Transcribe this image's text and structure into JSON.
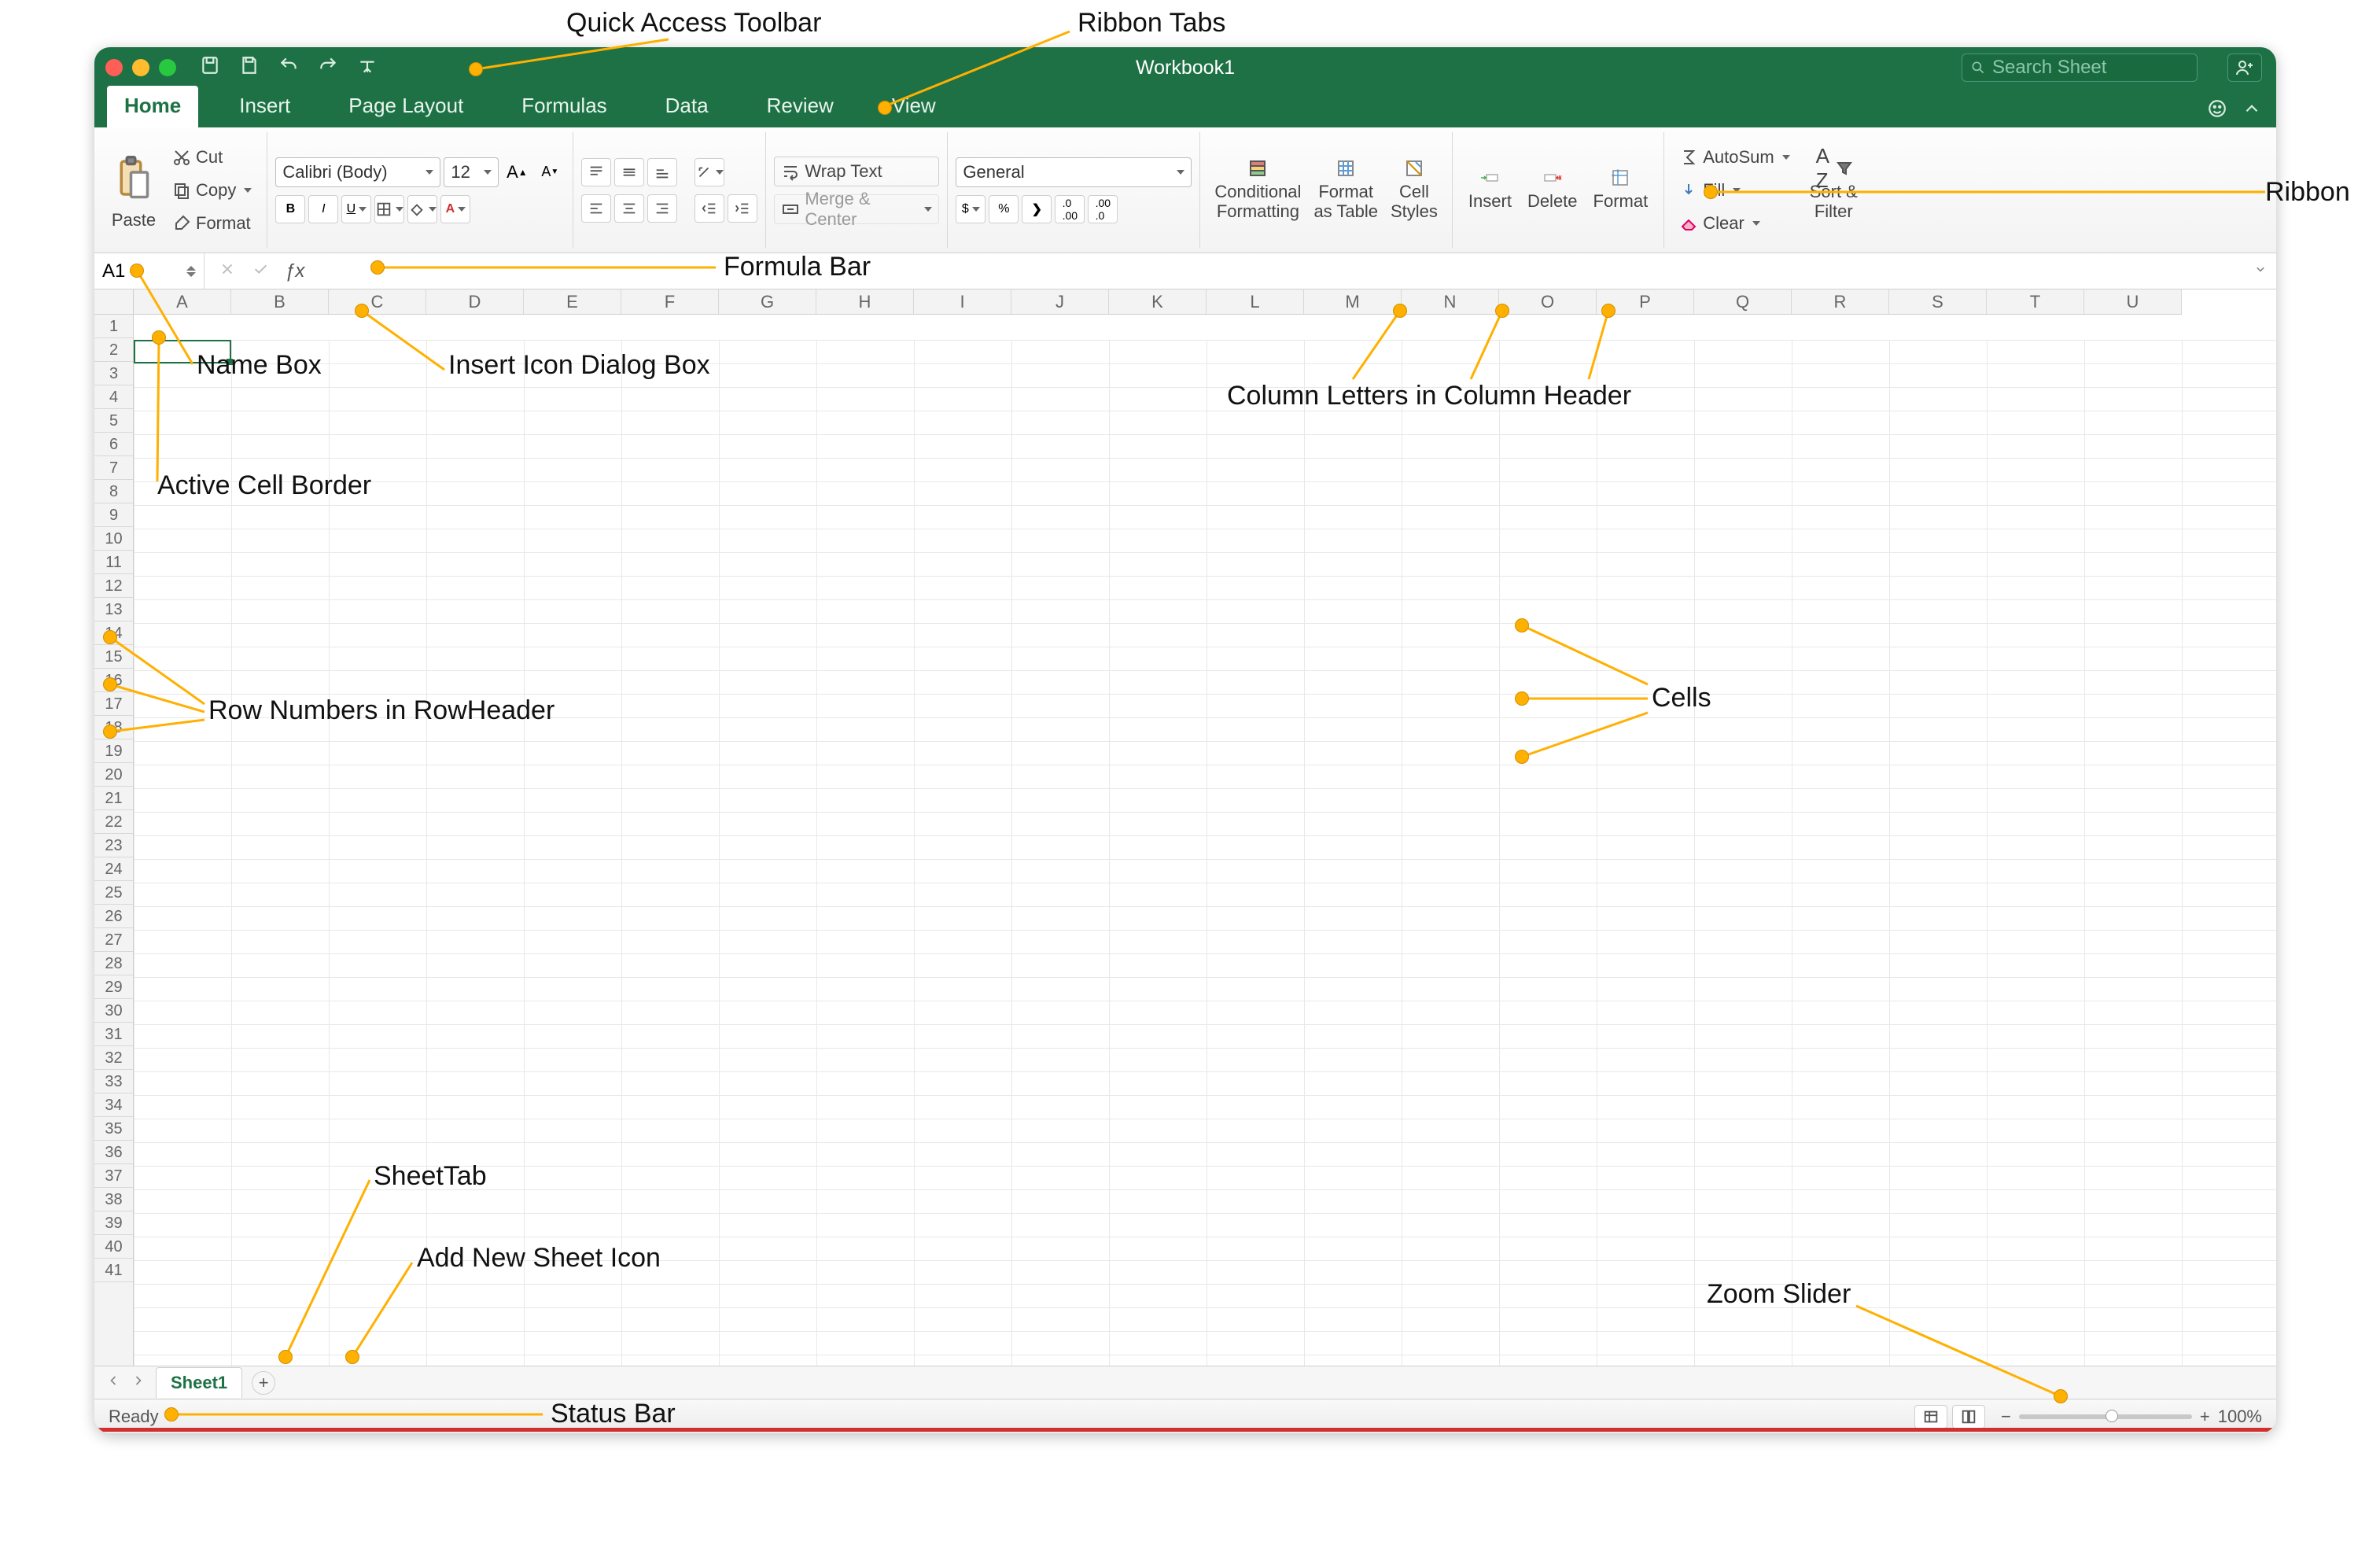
{
  "window": {
    "title": "Workbook1",
    "search_placeholder": "Search Sheet"
  },
  "ribbon_tabs": [
    "Home",
    "Insert",
    "Page Layout",
    "Formulas",
    "Data",
    "Review",
    "View"
  ],
  "active_tab": "Home",
  "ribbon": {
    "clipboard": {
      "paste": "Paste",
      "cut": "Cut",
      "copy": "Copy",
      "format": "Format"
    },
    "font": {
      "name": "Calibri (Body)",
      "size": "12"
    },
    "alignment": {
      "wrap": "Wrap Text",
      "merge": "Merge & Center"
    },
    "number": {
      "format": "General"
    },
    "styles": {
      "conditional": "Conditional\nFormatting",
      "table": "Format\nas Table",
      "cell": "Cell\nStyles"
    },
    "cells": {
      "insert": "Insert",
      "delete": "Delete",
      "format": "Format"
    },
    "editing": {
      "autosum": "AutoSum",
      "fill": "Fill",
      "clear": "Clear",
      "sortfilter": "Sort &\nFilter"
    }
  },
  "namebox": "A1",
  "columns": [
    "A",
    "B",
    "C",
    "D",
    "E",
    "F",
    "G",
    "H",
    "I",
    "J",
    "K",
    "L",
    "M",
    "N",
    "O",
    "P",
    "Q",
    "R",
    "S",
    "T",
    "U"
  ],
  "row_count": 41,
  "sheet_tab": "Sheet1",
  "status": {
    "ready": "Ready",
    "zoom": "100%"
  },
  "callouts": {
    "qat": "Quick Access Toolbar",
    "ribbon_tabs": "Ribbon Tabs",
    "ribbon": "Ribbon",
    "formula_bar": "Formula Bar",
    "name_box": "Name Box",
    "insert_icon": "Insert Icon Dialog Box",
    "active_cell": "Active Cell Border",
    "col_letters": "Column Letters in Column Header",
    "row_numbers": "Row Numbers in RowHeader",
    "cells": "Cells",
    "sheet_tab": "SheetTab",
    "add_sheet": "Add New Sheet Icon",
    "zoom": "Zoom Slider",
    "status_bar": "Status Bar"
  }
}
